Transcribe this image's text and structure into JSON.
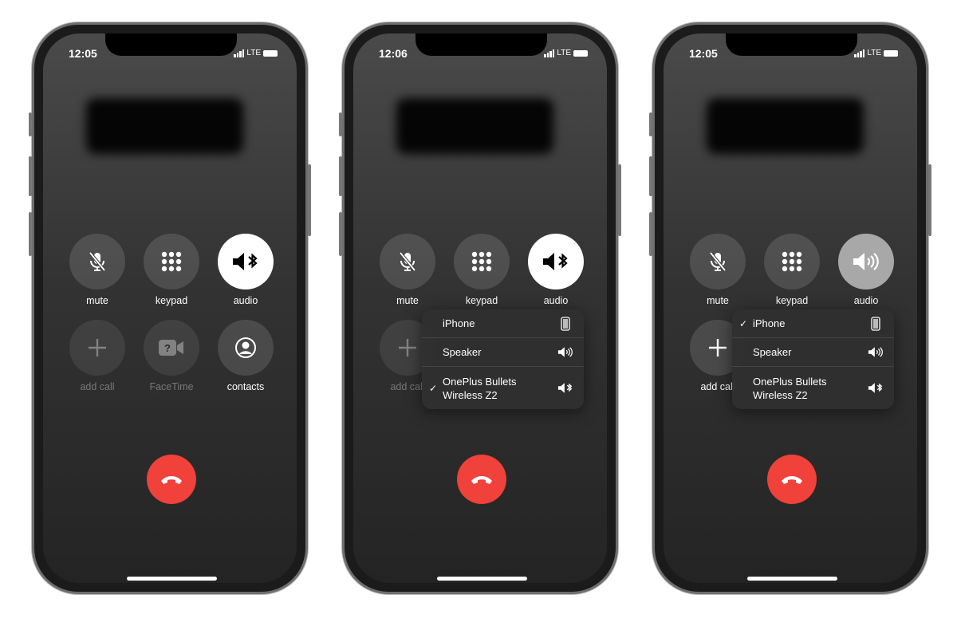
{
  "phones": [
    {
      "time": "12:05",
      "network": "LTE",
      "audio_style": "white",
      "audio_icon": "speaker-bluetooth-icon",
      "buttons": [
        {
          "label": "mute",
          "icon": "mic-slash-icon"
        },
        {
          "label": "keypad",
          "icon": "keypad-icon"
        },
        {
          "label": "audio",
          "icon": "speaker-bluetooth-icon"
        },
        {
          "label": "add call",
          "icon": "plus-icon",
          "disabled": true
        },
        {
          "label": "FaceTime",
          "icon": "facetime-icon",
          "disabled": true
        },
        {
          "label": "contacts",
          "icon": "contacts-icon"
        }
      ],
      "menu": null
    },
    {
      "time": "12:06",
      "network": "LTE",
      "audio_style": "white",
      "buttons": [
        {
          "label": "mute",
          "icon": "mic-slash-icon"
        },
        {
          "label": "keypad",
          "icon": "keypad-icon"
        },
        {
          "label": "audio",
          "icon": "speaker-bluetooth-icon"
        },
        {
          "label": "add call",
          "icon": "plus-icon",
          "disabled": true
        }
      ],
      "menu": [
        {
          "name": "iPhone",
          "icon": "iphone-icon",
          "checked": false
        },
        {
          "name": "Speaker",
          "icon": "speaker-icon",
          "checked": false
        },
        {
          "name": "OnePlus Bullets Wireless Z2",
          "line1": "OnePlus Bullets",
          "line2": "Wireless Z2",
          "icon": "speaker-bluetooth-icon",
          "checked": true
        }
      ]
    },
    {
      "time": "12:05",
      "network": "LTE",
      "audio_style": "grey",
      "buttons": [
        {
          "label": "mute",
          "icon": "mic-slash-icon"
        },
        {
          "label": "keypad",
          "icon": "keypad-icon"
        },
        {
          "label": "audio",
          "icon": "speaker-icon"
        },
        {
          "label": "add call",
          "icon": "plus-icon"
        }
      ],
      "menu": [
        {
          "name": "iPhone",
          "icon": "iphone-icon",
          "checked": true
        },
        {
          "name": "Speaker",
          "icon": "speaker-icon",
          "checked": false
        },
        {
          "name": "OnePlus Bullets Wireless Z2",
          "line1": "OnePlus Bullets",
          "line2": "Wireless Z2",
          "icon": "speaker-bluetooth-icon",
          "checked": false
        }
      ]
    }
  ],
  "checkmark": "✓",
  "colors": {
    "end_call": "#f0413a",
    "background": "#242424"
  }
}
